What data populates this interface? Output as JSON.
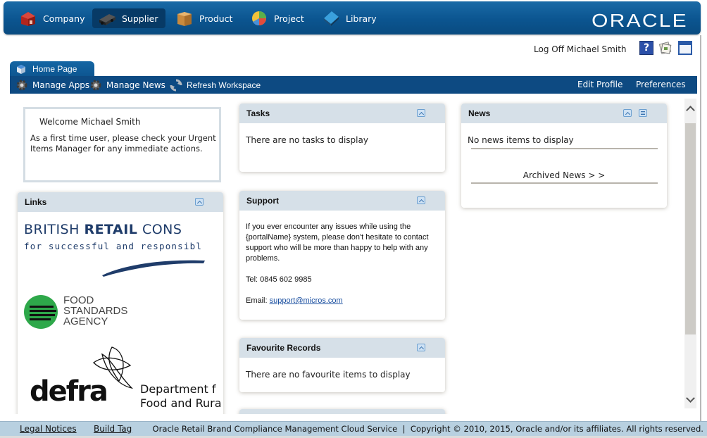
{
  "nav": {
    "items": [
      {
        "label": "Company",
        "icon": "company-icon",
        "active": false
      },
      {
        "label": "Supplier",
        "icon": "supplier-truck-icon",
        "active": true
      },
      {
        "label": "Product",
        "icon": "product-box-icon",
        "active": false
      },
      {
        "label": "Project",
        "icon": "project-chart-icon",
        "active": false
      },
      {
        "label": "Library",
        "icon": "library-book-icon",
        "active": false
      }
    ],
    "brand": "ORACLE"
  },
  "user": {
    "logoff_label": "Log Off Michael Smith",
    "icons": [
      "help-icon",
      "notes-icon",
      "window-icon"
    ],
    "help_glyph": "?"
  },
  "tabs": {
    "home_label": "Home Page"
  },
  "toolbar": {
    "manage_apps": "Manage Apps",
    "manage_news": "Manage News",
    "refresh_workspace": "Refresh Workspace",
    "edit_profile": "Edit Profile",
    "preferences": "Preferences"
  },
  "welcome": {
    "title": "Welcome Michael Smith",
    "text": "As a first time user, please check your Urgent Items Manager for any immediate actions."
  },
  "links": {
    "title": "Links",
    "brc": {
      "line1_a": "BRITISH ",
      "line1_b": "RETAIL",
      "line1_c": " CONS",
      "line2": "for successful and responsibl"
    },
    "fsa": {
      "line1": "FOOD",
      "line2": "STANDARDS",
      "line3": "AGENCY"
    },
    "defra": {
      "word": "defra",
      "line1": "Department f",
      "line2": "Food and Rura"
    }
  },
  "tasks": {
    "title": "Tasks",
    "empty": "There are no tasks to display"
  },
  "support": {
    "title": "Support",
    "paragraph": "If you ever encounter any issues while using the {portalName} system, please don't hesitate to contact support who will be more than happy to help with any problems.",
    "tel": "Tel: 0845 602 9985",
    "email_label": "Email: ",
    "email": "support@micros.com"
  },
  "favourites": {
    "title": "Favourite Records",
    "empty": "There are no favourite items to display"
  },
  "news": {
    "title": "News",
    "empty": "No news items to display",
    "archived": "Archived News > >"
  },
  "footer": {
    "legal": "Legal Notices",
    "build": "Build Tag",
    "copyright": "Oracle Retail Brand Compliance Management Cloud Service  |  Copyright © 2010, 2015, Oracle and/or its affiliates. All rights reserved."
  },
  "colors": {
    "nav_bg": "#0b5590",
    "toolbar_bg": "#0d4a82",
    "portlet_header": "#d6e0e8",
    "footer_bg": "#b8d0e0",
    "link": "#1a4fa0"
  }
}
